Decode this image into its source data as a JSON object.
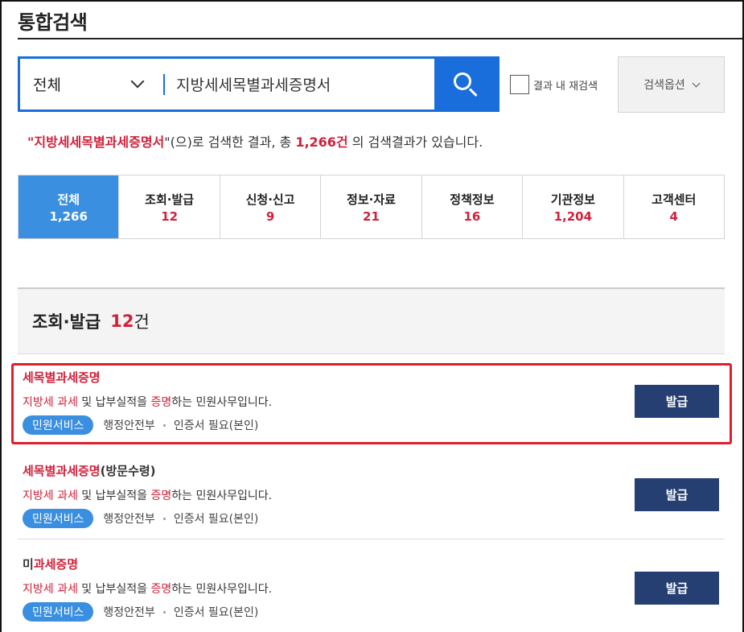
{
  "page_title": "통합검색",
  "search": {
    "category": "전체",
    "query": "지방세세목별과세증명서",
    "button_icon": "search-icon",
    "re_search_label": "결과 내 재검색",
    "options_label": "검색옵션"
  },
  "summary": {
    "open_quote": "\"",
    "keyword": "지방세세목별과세증명서",
    "mid": "\"(으)로 검색한 결과, 총 ",
    "count": "1,266건",
    "tail": " 의 검색결과가 있습니다."
  },
  "tabs": [
    {
      "label": "전체",
      "count": "1,266",
      "active": true
    },
    {
      "label": "조회·발급",
      "count": "12"
    },
    {
      "label": "신청·신고",
      "count": "9"
    },
    {
      "label": "정보·자료",
      "count": "21"
    },
    {
      "label": "정책정보",
      "count": "16"
    },
    {
      "label": "기관정보",
      "count": "1,204"
    },
    {
      "label": "고객센터",
      "count": "4"
    }
  ],
  "section": {
    "title": "조회·발급",
    "count": "12",
    "unit": "건"
  },
  "results": [
    {
      "title_hl": "세목별과세증명",
      "title_rest": "",
      "desc": {
        "a": "지방세",
        "b": " ",
        "c": "과세",
        "d": " 및 납부실적을 ",
        "e": "증명",
        "f": "하는 민원사무입니다."
      },
      "badge": "민원서비스",
      "org": "행정안전부",
      "cert": "인증서 필요(본인)",
      "button": "발급"
    },
    {
      "title_hl": "세목별과세증명",
      "title_rest": "(방문수령)",
      "desc": {
        "a": "지방세",
        "b": " ",
        "c": "과세",
        "d": " 및 납부실적을 ",
        "e": "증명",
        "f": "하는 민원사무입니다."
      },
      "badge": "민원서비스",
      "org": "행정안전부",
      "cert": "인증서 필요(본인)",
      "button": "발급"
    },
    {
      "title_pre": "미",
      "title_hl": "과세증명",
      "title_rest": "",
      "desc": {
        "a": "지방세",
        "b": " ",
        "c": "과세",
        "d": " 및 납부실적을 ",
        "e": "증명",
        "f": "하는 민원사무입니다."
      },
      "badge": "민원서비스",
      "org": "행정안전부",
      "cert": "인증서 필요(본인)",
      "button": "발급"
    }
  ],
  "colors": {
    "accent": "#1a6edb",
    "tab_active": "#3b8fe0",
    "highlight": "#d0213a",
    "button": "#263f73",
    "annotation": "#e01e2d"
  }
}
